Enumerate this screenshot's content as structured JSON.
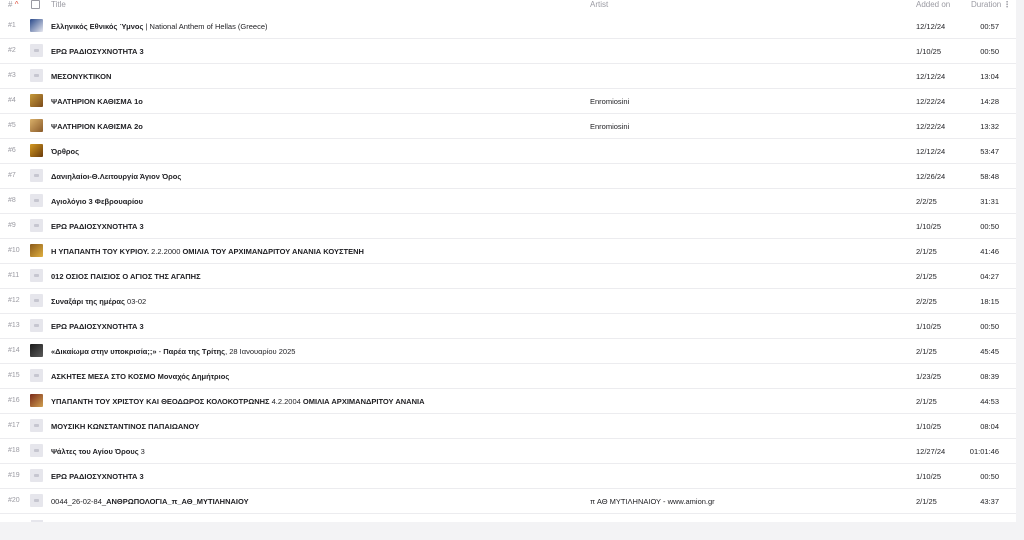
{
  "header": {
    "num_label": "#",
    "title_label": "Title",
    "artist_label": "Artist",
    "added_label": "Added on",
    "duration_label": "Duration",
    "more_label": "⋮"
  },
  "rows": [
    {
      "num": "#1",
      "title_bold": "Ελληνικός Εθνικός Ύμνος",
      "title_rest": " | National Anthem of Hellas (Greece)",
      "artist": "",
      "added": "12/12/24",
      "duration": "00:57",
      "thumb": "#2a4a8a",
      "thumb2": "#e8e8f0"
    },
    {
      "num": "#2",
      "title_bold": "ΕΡΩ ΡΑΔΙΟΣΥΧΝΟΤΗΤΑ 3",
      "title_rest": "",
      "artist": "",
      "added": "1/10/25",
      "duration": "00:50",
      "thumb": ""
    },
    {
      "num": "#3",
      "title_bold": "ΜΕΣΟΝΥΚΤΙΚΟΝ",
      "title_rest": "",
      "artist": "",
      "added": "12/12/24",
      "duration": "13:04",
      "thumb": ""
    },
    {
      "num": "#4",
      "title_bold": "ΨΑΛΤΗΡΙΟΝ ΚΑΘΙΣΜΑ 1ο",
      "title_rest": "",
      "artist": "Enromiosini",
      "added": "12/22/24",
      "duration": "14:28",
      "thumb": "#c79a3a",
      "thumb2": "#7a4a1a"
    },
    {
      "num": "#5",
      "title_bold": "ΨΑΛΤΗΡΙΟΝ ΚΑΘΙΣΜΑ 2ο",
      "title_rest": "",
      "artist": "Enromiosini",
      "added": "12/22/24",
      "duration": "13:32",
      "thumb": "#d9b06a",
      "thumb2": "#8a5a2a"
    },
    {
      "num": "#6",
      "title_bold": "Όρθρος",
      "title_rest": "",
      "artist": "",
      "added": "12/12/24",
      "duration": "53:47",
      "thumb": "#d49a22",
      "thumb2": "#6a3a0a"
    },
    {
      "num": "#7",
      "title_bold": "Δανιηλαίοι-Θ.Λειτουργία Άγιον Όρος",
      "title_rest": "",
      "artist": "",
      "added": "12/26/24",
      "duration": "58:48",
      "thumb": ""
    },
    {
      "num": "#8",
      "title_bold": "Αγιολόγιο 3 Φεβρουαρίου",
      "title_rest": "",
      "artist": "",
      "added": "2/2/25",
      "duration": "31:31",
      "thumb": ""
    },
    {
      "num": "#9",
      "title_bold": "ΕΡΩ ΡΑΔΙΟΣΥΧΝΟΤΗΤΑ 3",
      "title_rest": "",
      "artist": "",
      "added": "1/10/25",
      "duration": "00:50",
      "thumb": ""
    },
    {
      "num": "#10",
      "title_bold": "Η ΥΠΑΠΑΝΤΗ ΤΟΥ ΚΥΡΙΟΥ.",
      "title_rest": " 2.2.2000 ",
      "title_bold2": "ΟΜΙΛΙΑ ΤΟΥ ΑΡΧΙΜΑΝΔΡΙΤΟΥ ΑΝΑΝΙΑ ΚΟΥΣΤΕΝΗ",
      "artist": "",
      "added": "2/1/25",
      "duration": "41:46",
      "thumb": "#8a5a1a",
      "thumb2": "#e0b040"
    },
    {
      "num": "#11",
      "title_bold": "012 ΟΣΙΟΣ ΠΑΙΣΙΟΣ Ο ΑΓΙΟΣ ΤΗΣ ΑΓΑΠΗΣ",
      "title_rest": "",
      "artist": "",
      "added": "2/1/25",
      "duration": "04:27",
      "thumb": ""
    },
    {
      "num": "#12",
      "title_bold": "Συναξάρι της ημέρας",
      "title_rest": " 03-02",
      "artist": "",
      "added": "2/2/25",
      "duration": "18:15",
      "thumb": ""
    },
    {
      "num": "#13",
      "title_bold": "ΕΡΩ ΡΑΔΙΟΣΥΧΝΟΤΗΤΑ 3",
      "title_rest": "",
      "artist": "",
      "added": "1/10/25",
      "duration": "00:50",
      "thumb": ""
    },
    {
      "num": "#14",
      "title_bold": "«Δικαίωμα στην υποκρισία;;»",
      "title_rest": " - ",
      "title_bold2": "Παρέα της Τρίτης",
      "title_rest2": ", 28 Ιανουαρίου 2025",
      "artist": "",
      "added": "2/1/25",
      "duration": "45:45",
      "thumb": "#1a1a1a",
      "thumb2": "#5a5a5a"
    },
    {
      "num": "#15",
      "title_bold": "ΑΣΚΗΤΕΣ ΜΕΣΑ ΣΤΟ ΚΟΣΜΟ Μοναχός Δημήτριος",
      "title_rest": "",
      "artist": "",
      "added": "1/23/25",
      "duration": "08:39",
      "thumb": ""
    },
    {
      "num": "#16",
      "title_bold": "ΥΠΑΠΑΝΤΗ ΤΟΥ ΧΡΙΣΤΟΥ ΚΑΙ ΘΕΟΔΩΡΟΣ ΚΟΛΟΚΟΤΡΩΝΗΣ",
      "title_rest": " 4.2.2004 ",
      "title_bold2": "ΟΜΙΛΙΑ ΑΡΧΙΜΑΝΔΡΙΤΟΥ ΑΝΑΝΙΑ",
      "artist": "",
      "added": "2/1/25",
      "duration": "44:53",
      "thumb": "#7a2a1a",
      "thumb2": "#d0a050"
    },
    {
      "num": "#17",
      "title_bold": "ΜΟΥΣΙΚΗ ΚΩΝΣΤΑΝΤΙΝΟΣ ΠΑΠΑΙΩΑΝΟΥ",
      "title_rest": "",
      "artist": "",
      "added": "1/10/25",
      "duration": "08:04",
      "thumb": ""
    },
    {
      "num": "#18",
      "title_bold": "Ψάλτες του Αγίου Όρους",
      "title_rest": " 3",
      "artist": "",
      "added": "12/27/24",
      "duration": "01:01:46",
      "thumb": ""
    },
    {
      "num": "#19",
      "title_bold": "ΕΡΩ ΡΑΔΙΟΣΥΧΝΟΤΗΤΑ 3",
      "title_rest": "",
      "artist": "",
      "added": "1/10/25",
      "duration": "00:50",
      "thumb": ""
    },
    {
      "num": "#20",
      "title_bold": "",
      "title_rest": "0044_26-02-84_",
      "title_bold2": "ΑΝΘΡΩΠΟΛΟΓΙΑ_π_ΑΘ_ΜΥΤΙΛΗΝΑΙΟΥ",
      "artist": "π ΑΘ ΜΥΤΙΛΗΝΑΙΟΥ - www.amion.gr",
      "added": "2/1/25",
      "duration": "43:37",
      "thumb": ""
    }
  ]
}
